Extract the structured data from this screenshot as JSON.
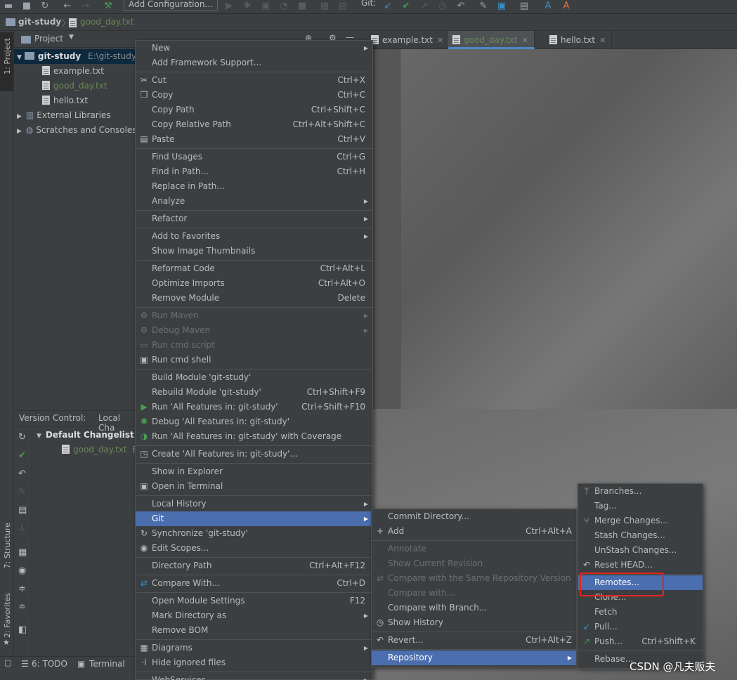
{
  "toolbar": {
    "add_configuration": "Add Configuration...",
    "git_label": "Git:"
  },
  "navbar": {
    "project": "git-study",
    "file": "good_day.txt"
  },
  "left_tabs": {
    "project": "1: Project",
    "structure": "7: Structure",
    "favorites": "2: Favorites"
  },
  "project_panel": {
    "title": "Project",
    "root": {
      "name": "git-study",
      "path": "E:\\git-study"
    },
    "files": [
      "example.txt",
      "good_day.txt",
      "hello.txt"
    ],
    "external_libraries": "External Libraries",
    "scratches": "Scratches and Consoles"
  },
  "editor_tabs": [
    "example.txt",
    "good_day.txt",
    "hello.txt"
  ],
  "version_control": {
    "title": "Version Control:",
    "tab": "Local Cha",
    "changelist": "Default Changelist",
    "changed_file": "good_day.txt",
    "changed_file_suffix": "E"
  },
  "bottom_bar": {
    "todo": "6: TODO",
    "terminal": "Terminal"
  },
  "context_menu": [
    {
      "label": "New",
      "arrow": true
    },
    {
      "label": "Add Framework Support..."
    },
    {
      "sep": true
    },
    {
      "label": "Cut",
      "shortcut": "Ctrl+X",
      "icon": "scissors-icon"
    },
    {
      "label": "Copy",
      "shortcut": "Ctrl+C",
      "icon": "copy-icon"
    },
    {
      "label": "Copy Path",
      "shortcut": "Ctrl+Shift+C"
    },
    {
      "label": "Copy Relative Path",
      "shortcut": "Ctrl+Alt+Shift+C"
    },
    {
      "label": "Paste",
      "shortcut": "Ctrl+V",
      "icon": "paste-icon"
    },
    {
      "sep": true
    },
    {
      "label": "Find Usages",
      "shortcut": "Ctrl+G"
    },
    {
      "label": "Find in Path...",
      "shortcut": "Ctrl+H"
    },
    {
      "label": "Replace in Path..."
    },
    {
      "label": "Analyze",
      "arrow": true
    },
    {
      "sep": true
    },
    {
      "label": "Refactor",
      "arrow": true
    },
    {
      "sep": true
    },
    {
      "label": "Add to Favorites",
      "arrow": true
    },
    {
      "label": "Show Image Thumbnails"
    },
    {
      "sep": true
    },
    {
      "label": "Reformat Code",
      "shortcut": "Ctrl+Alt+L"
    },
    {
      "label": "Optimize Imports",
      "shortcut": "Ctrl+Alt+O"
    },
    {
      "label": "Remove Module",
      "shortcut": "Delete"
    },
    {
      "sep": true
    },
    {
      "label": "Run Maven",
      "arrow": true,
      "disabled": true,
      "icon": "gear-icon"
    },
    {
      "label": "Debug Maven",
      "arrow": true,
      "disabled": true,
      "icon": "gear-icon"
    },
    {
      "label": "Run cmd script",
      "disabled": true,
      "icon": "script-icon"
    },
    {
      "label": "Run cmd shell",
      "icon": "cmd-icon"
    },
    {
      "sep": true
    },
    {
      "label": "Build Module 'git-study'"
    },
    {
      "label": "Rebuild Module 'git-study'",
      "shortcut": "Ctrl+Shift+F9"
    },
    {
      "label": "Run 'All Features in: git-study'",
      "shortcut": "Ctrl+Shift+F10",
      "icon": "run-icon"
    },
    {
      "label": "Debug 'All Features in: git-study'",
      "icon": "debug-icon"
    },
    {
      "label": "Run 'All Features in: git-study' with Coverage",
      "icon": "coverage-icon"
    },
    {
      "sep": true
    },
    {
      "label": "Create 'All Features in: git-study'...",
      "icon": "create-config-icon"
    },
    {
      "sep": true
    },
    {
      "label": "Show in Explorer"
    },
    {
      "label": "Open in Terminal",
      "icon": "terminal-icon"
    },
    {
      "sep": true
    },
    {
      "label": "Local History",
      "arrow": true
    },
    {
      "label": "Git",
      "arrow": true,
      "selected": true
    },
    {
      "label": "Synchronize 'git-study'",
      "icon": "sync-icon"
    },
    {
      "label": "Edit Scopes...",
      "icon": "scope-icon"
    },
    {
      "sep": true
    },
    {
      "label": "Directory Path",
      "shortcut": "Ctrl+Alt+F12"
    },
    {
      "sep": true
    },
    {
      "label": "Compare With...",
      "shortcut": "Ctrl+D",
      "icon": "compare-icon"
    },
    {
      "sep": true
    },
    {
      "label": "Open Module Settings",
      "shortcut": "F12"
    },
    {
      "label": "Mark Directory as",
      "arrow": true
    },
    {
      "label": "Remove BOM"
    },
    {
      "sep": true
    },
    {
      "label": "Diagrams",
      "arrow": true,
      "icon": "diagram-icon"
    },
    {
      "label": "Hide ignored files",
      "icon": "ignored-icon"
    },
    {
      "sep": true
    },
    {
      "label": "WebServices",
      "arrow": true
    }
  ],
  "git_menu": [
    {
      "label": "Commit Directory..."
    },
    {
      "label": "Add",
      "shortcut": "Ctrl+Alt+A",
      "icon": "plus-icon"
    },
    {
      "sep": true
    },
    {
      "label": "Annotate",
      "disabled": true
    },
    {
      "label": "Show Current Revision",
      "disabled": true
    },
    {
      "label": "Compare with the Same Repository Version",
      "disabled": true,
      "icon": "compare-icon"
    },
    {
      "label": "Compare with...",
      "disabled": true
    },
    {
      "label": "Compare with Branch..."
    },
    {
      "label": "Show History",
      "icon": "clock-icon"
    },
    {
      "sep": true
    },
    {
      "label": "Revert...",
      "shortcut": "Ctrl+Alt+Z",
      "icon": "revert-icon"
    },
    {
      "sep": true
    },
    {
      "label": "Repository",
      "arrow": true,
      "selected": true
    }
  ],
  "repository_menu": [
    {
      "label": "Branches...",
      "icon": "branch-icon"
    },
    {
      "label": "Tag..."
    },
    {
      "label": "Merge Changes...",
      "icon": "merge-icon"
    },
    {
      "label": "Stash Changes..."
    },
    {
      "label": "UnStash Changes..."
    },
    {
      "label": "Reset HEAD...",
      "icon": "revert-icon"
    },
    {
      "sep": true
    },
    {
      "label": "Remotes...",
      "selected": true
    },
    {
      "label": "Clone..."
    },
    {
      "label": "Fetch"
    },
    {
      "label": "Pull...",
      "icon": "pull-icon"
    },
    {
      "label": "Push...",
      "shortcut": "Ctrl+Shift+K",
      "icon": "push-icon"
    },
    {
      "sep": true
    },
    {
      "label": "Rebase..."
    }
  ],
  "watermark": "CSDN @凡夫贩夫",
  "colors": {
    "selection": "#4b6eaf",
    "modified_file": "#6a8759",
    "highlight_box": "#e8221e"
  }
}
